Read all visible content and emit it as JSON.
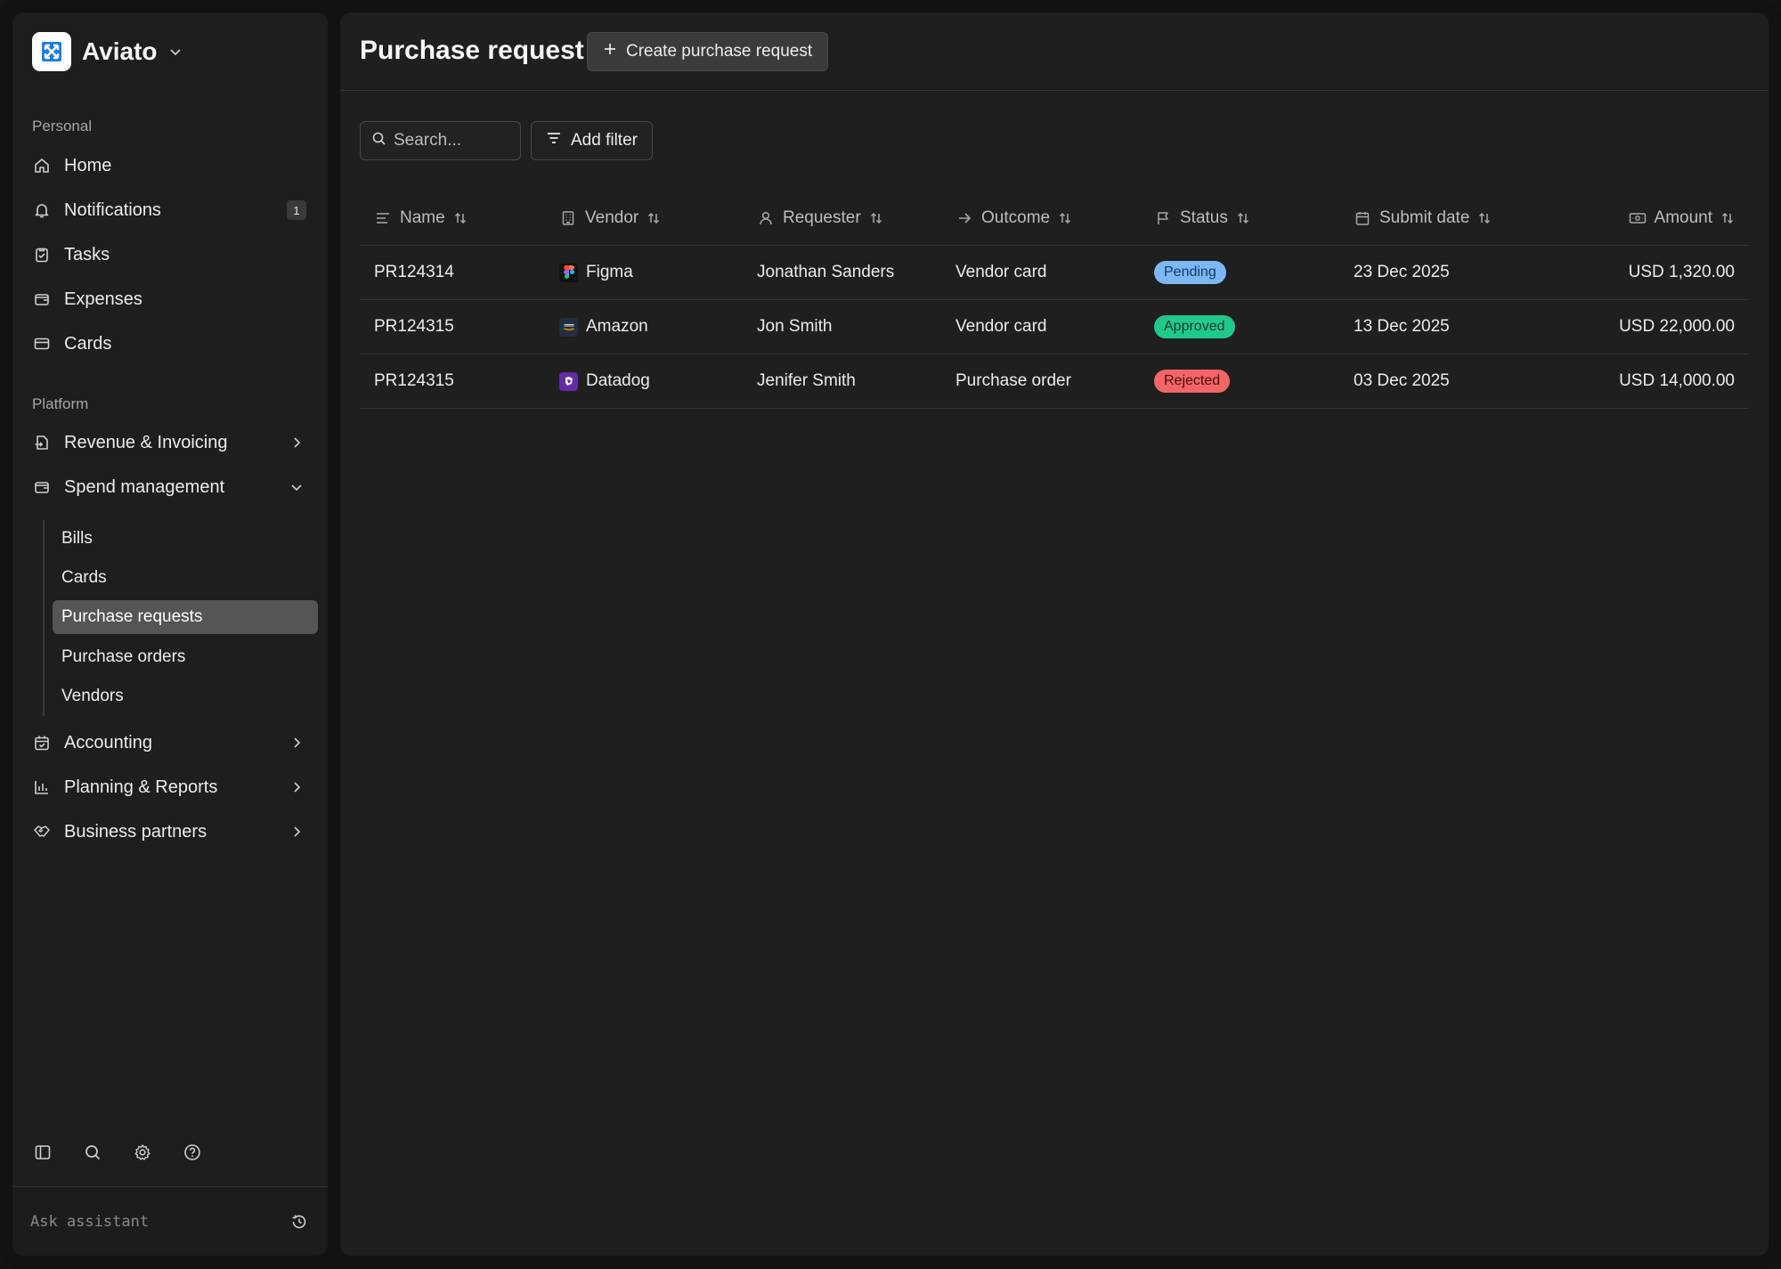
{
  "app": {
    "name": "Aviato",
    "colors": {
      "brand_logo": "#1d7ce8"
    }
  },
  "sidebar": {
    "personal_label": "Personal",
    "personal_items": [
      {
        "label": "Home",
        "icon": "home-icon"
      },
      {
        "label": "Notifications",
        "icon": "bell-icon",
        "badge": "1"
      },
      {
        "label": "Tasks",
        "icon": "clipboard-check-icon"
      },
      {
        "label": "Expenses",
        "icon": "wallet-icon"
      },
      {
        "label": "Cards",
        "icon": "credit-card-icon"
      }
    ],
    "platform_label": "Platform",
    "platform_items": [
      {
        "label": "Revenue & Invoicing",
        "icon": "invoice-icon",
        "state": "collapsed"
      },
      {
        "label": "Spend management",
        "icon": "wallet-icon",
        "state": "expanded"
      },
      {
        "label": "Accounting",
        "icon": "calendar-check-icon",
        "state": "collapsed"
      },
      {
        "label": "Planning & Reports",
        "icon": "bar-chart-icon",
        "state": "collapsed"
      },
      {
        "label": "Business partners",
        "icon": "handshake-icon",
        "state": "collapsed"
      }
    ],
    "spend_sub_items": [
      {
        "label": "Bills"
      },
      {
        "label": "Cards"
      },
      {
        "label": "Purchase requests",
        "active": true
      },
      {
        "label": "Purchase orders"
      },
      {
        "label": "Vendors"
      }
    ],
    "tools": [
      "sidebar-toggle-icon",
      "search-icon",
      "gear-icon",
      "help-icon"
    ],
    "assistant": {
      "placeholder": "Ask assistant"
    }
  },
  "main": {
    "title": "Purchase request",
    "create_button": "Create purchase request",
    "search_placeholder": "Search...",
    "filter_button": "Add filter",
    "columns": [
      {
        "label": "Name",
        "icon": "text-lines-icon"
      },
      {
        "label": "Vendor",
        "icon": "building-icon"
      },
      {
        "label": "Requester",
        "icon": "user-icon"
      },
      {
        "label": "Outcome",
        "icon": "arrow-right-icon"
      },
      {
        "label": "Status",
        "icon": "flag-icon"
      },
      {
        "label": "Submit date",
        "icon": "calendar-icon"
      },
      {
        "label": "Amount",
        "icon": "cash-icon"
      }
    ],
    "rows": [
      {
        "name": "PR124314",
        "vendor": "Figma",
        "vendor_icon": "figma-logo-icon",
        "requester": "Jonathan Sanders",
        "outcome": "Vendor card",
        "status": "Pending",
        "submit_date": "23 Dec 2025",
        "amount": "USD 1,320.00"
      },
      {
        "name": "PR124315",
        "vendor": "Amazon",
        "vendor_icon": "aws-logo-icon",
        "requester": "Jon Smith",
        "outcome": "Vendor card",
        "status": "Approved",
        "submit_date": "13 Dec 2025",
        "amount": "USD 22,000.00"
      },
      {
        "name": "PR124315",
        "vendor": "Datadog",
        "vendor_icon": "datadog-logo-icon",
        "requester": "Jenifer Smith",
        "outcome": "Purchase order",
        "status": "Rejected",
        "submit_date": "03 Dec 2025",
        "amount": "USD 14,000.00"
      }
    ],
    "status_colors": {
      "Pending": {
        "bg": "#7fb7f5",
        "fg": "#0f3a6b"
      },
      "Approved": {
        "bg": "#1fc98a",
        "fg": "#0a3d27"
      },
      "Rejected": {
        "bg": "#f36566",
        "fg": "#4a0c0c"
      }
    }
  }
}
